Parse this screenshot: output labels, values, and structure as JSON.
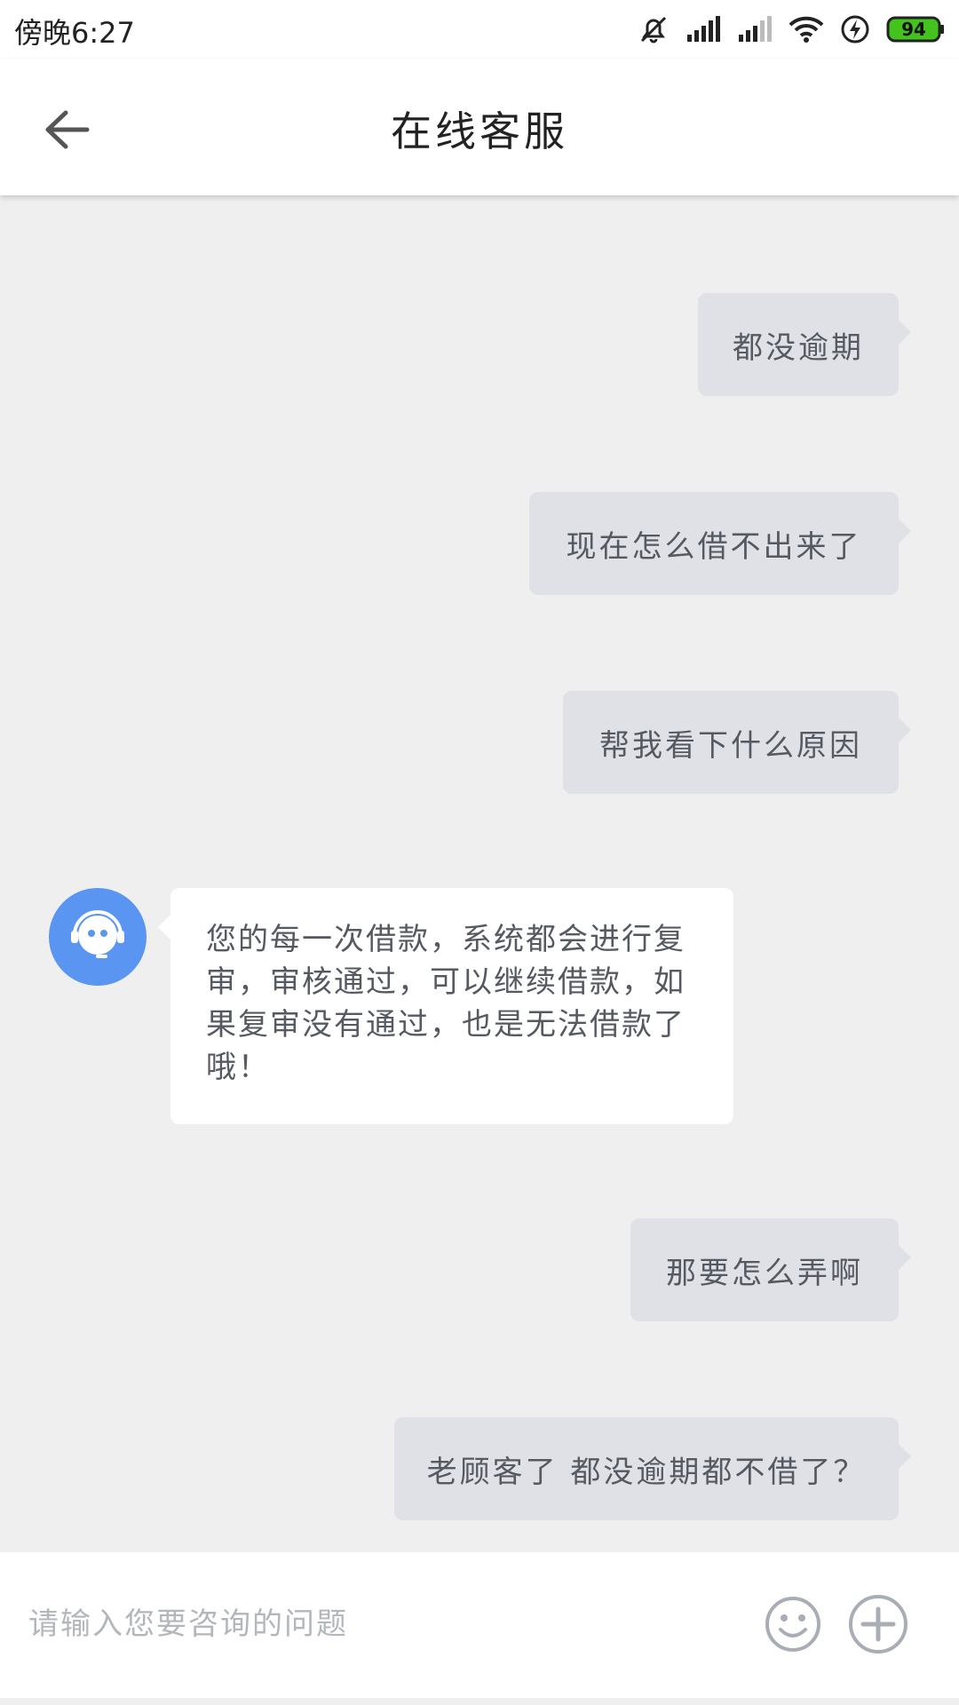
{
  "status_bar": {
    "time": "傍晚6:27",
    "battery": "94"
  },
  "header": {
    "title": "在线客服"
  },
  "messages": [
    {
      "side": "out",
      "text": "都没逾期"
    },
    {
      "side": "out",
      "text": "现在怎么借不出来了"
    },
    {
      "side": "out",
      "text": "帮我看下什么原因"
    },
    {
      "side": "in",
      "text": "您的每一次借款，系统都会进行复审，审核通过，可以继续借款，如果复审没有通过，也是无法借款了哦！"
    },
    {
      "side": "out",
      "text": "那要怎么弄啊"
    },
    {
      "side": "out",
      "text": "老顾客了 都没逾期都不借了？"
    }
  ],
  "input": {
    "placeholder": "请输入您要咨询的问题"
  },
  "colors": {
    "accent": "#5b95f2",
    "outgoing_bubble": "#dfe1e6",
    "incoming_bubble": "#ffffff",
    "background": "#efefef",
    "battery_green": "#44c21d"
  }
}
